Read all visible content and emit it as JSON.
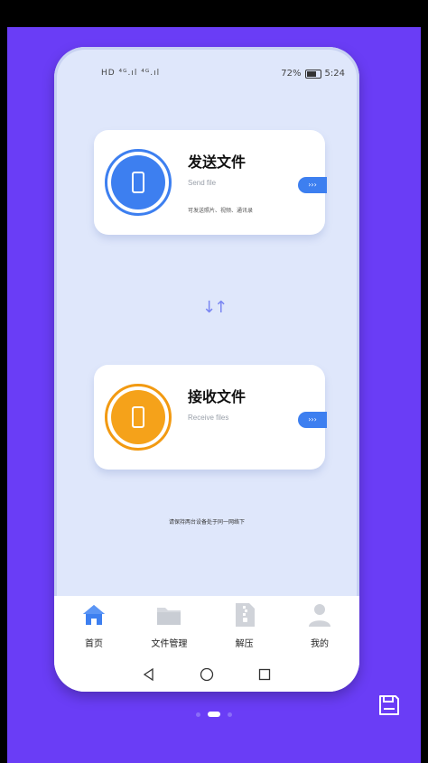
{
  "status_bar": {
    "left_indicators": "HD ⁴ᴳ.ıl ⁴ᴳ.ıl",
    "battery_percent": "72%",
    "time": "5:24"
  },
  "send_card": {
    "title": "发送文件",
    "subtitle": "Send file",
    "description": "可发送照片、视频、通讯录",
    "go_label": "›››"
  },
  "receive_card": {
    "title": "接收文件",
    "subtitle": "Receive files",
    "go_label": "›››"
  },
  "swap_arrows": "↓↑",
  "hint_text": "请保持两台设备处于同一网络下",
  "tabs": [
    {
      "label": "首页",
      "icon": "home-icon",
      "active": true
    },
    {
      "label": "文件管理",
      "icon": "folder-icon",
      "active": false
    },
    {
      "label": "解压",
      "icon": "zip-icon",
      "active": false
    },
    {
      "label": "我的",
      "icon": "user-icon",
      "active": false
    }
  ],
  "colors": {
    "accent_blue": "#3d7ff0",
    "accent_orange": "#f5a21a",
    "background_purple": "#6a3df6",
    "page_bg": "#dfe7fb"
  }
}
